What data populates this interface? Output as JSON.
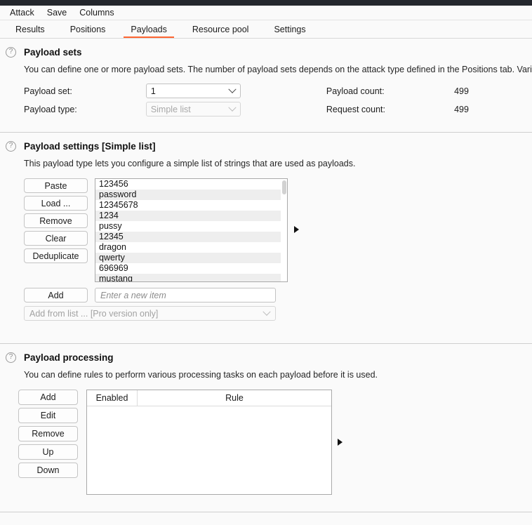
{
  "menubar": {
    "items": [
      {
        "label": "Attack"
      },
      {
        "label": "Save"
      },
      {
        "label": "Columns"
      }
    ]
  },
  "tabs": [
    {
      "label": "Results",
      "active": false
    },
    {
      "label": "Positions",
      "active": false
    },
    {
      "label": "Payloads",
      "active": true
    },
    {
      "label": "Resource pool",
      "active": false
    },
    {
      "label": "Settings",
      "active": false
    }
  ],
  "colors": {
    "accent": "#ff6633",
    "titlebar": "#24272d",
    "background": "#fafafa",
    "row_stripe": "#eeeeee"
  },
  "payload_sets": {
    "help_icon": "question-circle-icon",
    "title": "Payload sets",
    "description": "You can define one or more payload sets. The number of payload sets depends on the attack type defined in the Positions tab. Various payload types are a",
    "payload_set_label": "Payload set:",
    "payload_set_value": "1",
    "payload_type_label": "Payload type:",
    "payload_type_value": "Simple list",
    "payload_count_label": "Payload count:",
    "payload_count_value": "499",
    "request_count_label": "Request count:",
    "request_count_value": "499"
  },
  "payload_settings": {
    "help_icon": "question-circle-icon",
    "title": "Payload settings [Simple list]",
    "description": "This payload type lets you configure a simple list of strings that are used as payloads.",
    "buttons": [
      {
        "label": "Paste"
      },
      {
        "label": "Load ..."
      },
      {
        "label": "Remove"
      },
      {
        "label": "Clear"
      },
      {
        "label": "Deduplicate"
      }
    ],
    "items": [
      "123456",
      "password",
      "12345678",
      "1234",
      "pussy",
      "12345",
      "dragon",
      "qwerty",
      "696969",
      "mustang"
    ],
    "add_button": "Add",
    "add_placeholder": "Enter a new item",
    "add_value": "",
    "add_from_list": "Add from list ... [Pro version only]",
    "expander_icon": "triangle-right-icon"
  },
  "payload_processing": {
    "help_icon": "question-circle-icon",
    "title": "Payload processing",
    "description": "You can define rules to perform various processing tasks on each payload before it is used.",
    "buttons": [
      {
        "label": "Add"
      },
      {
        "label": "Edit"
      },
      {
        "label": "Remove"
      },
      {
        "label": "Up"
      },
      {
        "label": "Down"
      }
    ],
    "columns": [
      {
        "label": "Enabled"
      },
      {
        "label": "Rule"
      }
    ],
    "rows": [],
    "expander_icon": "triangle-right-icon"
  }
}
